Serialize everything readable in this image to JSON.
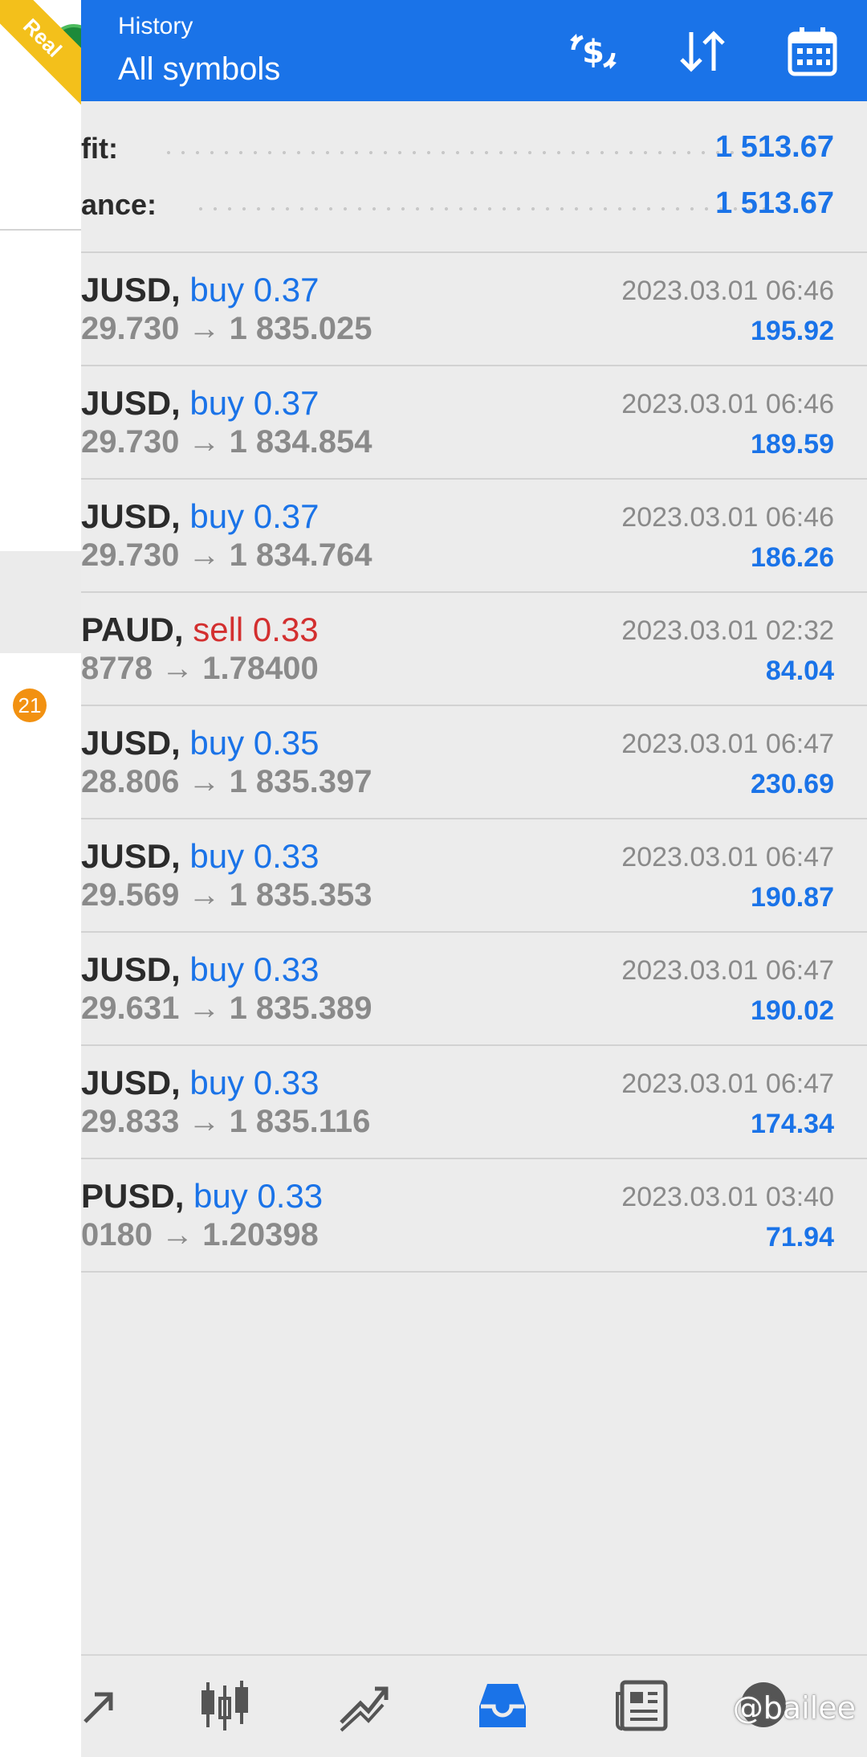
{
  "drawer": {
    "badge_count": "21",
    "account_type": "Real"
  },
  "header": {
    "subtitle": "History",
    "title": "All symbols"
  },
  "summary": {
    "profit_label": "fit:",
    "profit_value": "1 513.67",
    "balance_label": "ance:",
    "balance_value": "1 513.67"
  },
  "trades": [
    {
      "symbol": "JUSD,",
      "side": "buy 0.37",
      "type": "buy",
      "prices": "29.730 → 1 835.025",
      "time": "2023.03.01 06:46",
      "profit": "195.92"
    },
    {
      "symbol": "JUSD,",
      "side": "buy 0.37",
      "type": "buy",
      "prices": "29.730 → 1 834.854",
      "time": "2023.03.01 06:46",
      "profit": "189.59"
    },
    {
      "symbol": "JUSD,",
      "side": "buy 0.37",
      "type": "buy",
      "prices": "29.730 → 1 834.764",
      "time": "2023.03.01 06:46",
      "profit": "186.26"
    },
    {
      "symbol": "PAUD,",
      "side": "sell 0.33",
      "type": "sell",
      "prices": "8778 → 1.78400",
      "time": "2023.03.01 02:32",
      "profit": "84.04"
    },
    {
      "symbol": "JUSD,",
      "side": "buy 0.35",
      "type": "buy",
      "prices": "28.806 → 1 835.397",
      "time": "2023.03.01 06:47",
      "profit": "230.69"
    },
    {
      "symbol": "JUSD,",
      "side": "buy 0.33",
      "type": "buy",
      "prices": "29.569 → 1 835.353",
      "time": "2023.03.01 06:47",
      "profit": "190.87"
    },
    {
      "symbol": "JUSD,",
      "side": "buy 0.33",
      "type": "buy",
      "prices": "29.631 → 1 835.389",
      "time": "2023.03.01 06:47",
      "profit": "190.02"
    },
    {
      "symbol": "JUSD,",
      "side": "buy 0.33",
      "type": "buy",
      "prices": "29.833 → 1 835.116",
      "time": "2023.03.01 06:47",
      "profit": "174.34"
    },
    {
      "symbol": "PUSD,",
      "side": "buy 0.33",
      "type": "buy",
      "prices": "0180 → 1.20398",
      "time": "2023.03.01 03:40",
      "profit": "71.94"
    }
  ],
  "nav": {
    "items": [
      "trade-icon",
      "chart-candles-icon",
      "analytics-icon",
      "history-inbox-icon",
      "news-icon",
      "chat-icon"
    ]
  },
  "watermark": "@bailee",
  "colors": {
    "accent": "#1a73e8",
    "sell": "#d32f2f",
    "badge": "#f29111",
    "ribbon": "#f3c01b"
  }
}
